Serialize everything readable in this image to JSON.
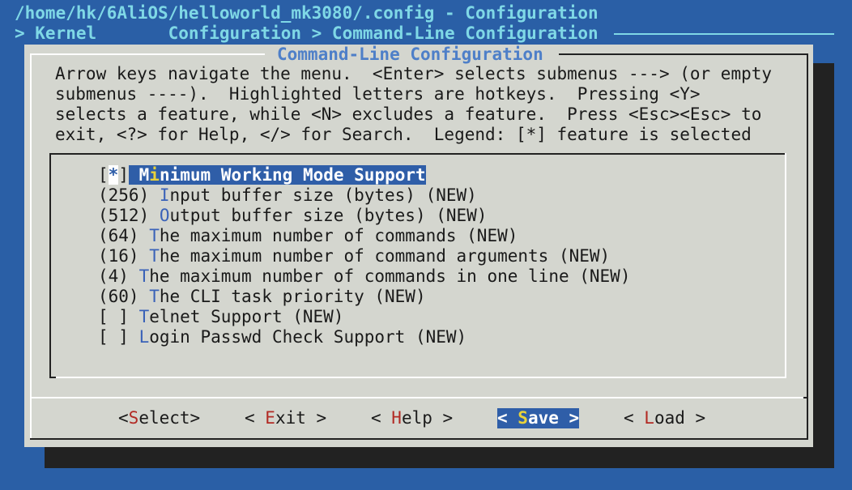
{
  "window": {
    "title": "/home/hk/6AliOS/helloworld_mk3080/.config - Configuration",
    "breadcrumb": "> Kernel       Configuration > Command-Line Configuration"
  },
  "dialog": {
    "title": "Command-Line Configuration",
    "help_lines": [
      "Arrow keys navigate the menu.  <Enter> selects submenus ---> (or empty",
      "submenus ----).  Highlighted letters are hotkeys.  Pressing <Y>",
      "selects a feature, while <N> excludes a feature.  Press <Esc><Esc> to",
      "exit, <?> for Help, </> for Search.  Legend: [*] feature is selected"
    ]
  },
  "menu": {
    "items": [
      {
        "prefix": "[*] ",
        "hotkey": "M",
        "hotkey_pre": "",
        "label_pre": "",
        "label_hk": "i",
        "label_rest": "nimum Working Mode Support",
        "lead": "M"
      },
      {
        "prefix": "(256) ",
        "hotkey": "I",
        "rest": "nput buffer size (bytes) (NEW)"
      },
      {
        "prefix": "(512) ",
        "hotkey": "O",
        "rest": "utput buffer size (bytes) (NEW)"
      },
      {
        "prefix": "(64) ",
        "hotkey": "T",
        "rest": "he maximum number of commands (NEW)"
      },
      {
        "prefix": "(16) ",
        "hotkey": "T",
        "rest": "he maximum number of command arguments (NEW)"
      },
      {
        "prefix": "(4) ",
        "hotkey": "T",
        "rest": "he maximum number of commands in one line (NEW)"
      },
      {
        "prefix": "(60) ",
        "hotkey": "T",
        "rest": "he CLI task priority (NEW)"
      },
      {
        "prefix": "[ ] ",
        "hotkey": "T",
        "rest": "elnet Support (NEW)"
      },
      {
        "prefix": "[ ] ",
        "hotkey": "L",
        "rest": "ogin Passwd Check Support (NEW)"
      }
    ],
    "selected_index": 0
  },
  "buttons": {
    "select": {
      "open": "<",
      "hotkey": "S",
      "rest": "elect",
      "close": ">"
    },
    "exit": {
      "open": "< ",
      "hotkey": "E",
      "rest": "xit",
      "close": " >"
    },
    "help": {
      "open": "< ",
      "hotkey": "H",
      "rest": "elp",
      "close": " >"
    },
    "save": {
      "open": "< ",
      "hotkey": "S",
      "rest": "ave",
      "close": " >"
    },
    "load": {
      "open": "< ",
      "hotkey": "L",
      "rest": "oad",
      "close": " >"
    }
  },
  "colors": {
    "background": "#2a5fa6",
    "dialog": "#d4d6cf",
    "title_text": "#7fd8e6",
    "selection": "#2f5ea8",
    "hotkey": "#3a62b8",
    "button_hotkey": "#b22a24",
    "selected_hotkey": "#e8d23a"
  }
}
